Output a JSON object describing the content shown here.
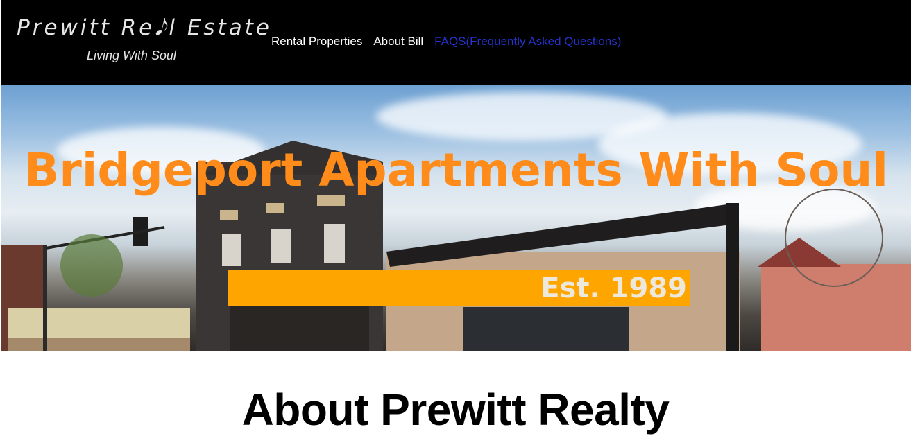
{
  "header": {
    "logo_title": "Prewitt Re𝅘𝅥𝅮l Estate",
    "logo_tagline": "Living With Soul",
    "nav": [
      {
        "label": "Rental Properties"
      },
      {
        "label": "About Bill"
      },
      {
        "label": "FAQS(Frequently Asked Questions)"
      }
    ]
  },
  "hero": {
    "title": "Bridgeport Apartments With Soul",
    "est": "Est. 1989"
  },
  "main": {
    "heading": "About Prewitt Realty"
  },
  "colors": {
    "header_bg": "#000000",
    "nav_active": "#2433c9",
    "hero_title": "#ff8c1a",
    "est_bar": "#ffa500"
  }
}
